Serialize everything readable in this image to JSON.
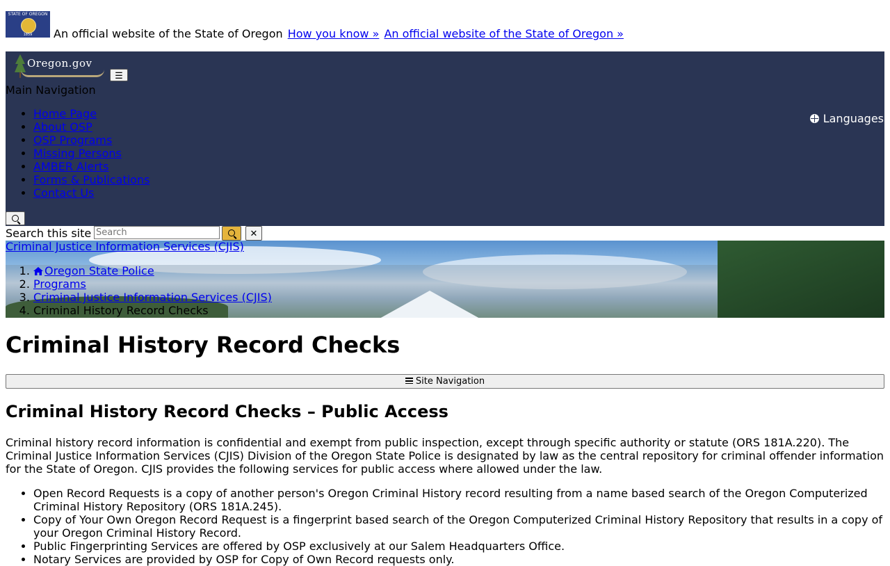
{
  "banner": {
    "flag_alt": "State of Oregon flag",
    "flag_top_text": "STATE OF OREGON",
    "flag_year": "1859",
    "text": "An official website of the State of Oregon",
    "how_link": "How you know »",
    "official_link": "An official website of the State of Oregon »"
  },
  "header": {
    "logo_text": "Oregon.gov",
    "menu_button_label": "☰",
    "main_nav_label": "Main Navigation",
    "nav_items": [
      {
        "label": "Home Page"
      },
      {
        "label": "About OSP"
      },
      {
        "label": "OSP Programs"
      },
      {
        "label": "Missing Persons"
      },
      {
        "label": "AMBER Alerts"
      },
      {
        "label": "Forms & Publications"
      },
      {
        "label": "Contact Us"
      }
    ],
    "languages_label": "Languages"
  },
  "search": {
    "label": "Search this site",
    "placeholder": "Search",
    "close_label": "✕"
  },
  "hero": {
    "title": "Criminal Justice Information Services (CJIS)",
    "breadcrumbs": [
      {
        "label": "Oregon State Police"
      },
      {
        "label": "Programs"
      },
      {
        "label": "Criminal Justice Information Services (CJIS)"
      },
      {
        "label": "Criminal History Record Checks"
      }
    ]
  },
  "main": {
    "page_title": "Criminal History Record Checks",
    "site_nav_label": "Site Navigation",
    "section_title": "Criminal History Record Checks – Public Access",
    "intro": "Criminal history record information is confidential and exempt from public inspection, except through specific authority or statute (ORS 181A.220). The Criminal Justice Information Services (CJIS) Division of the Oregon State Police is designated by law as the central repository for criminal offender information for the State of Oregon. CJIS provides the following services for public access where allowed under the law.",
    "services": [
      "Open Record Requests is a copy of another person's Oregon Criminal History record resulting from a name based search of the Oregon Computerized Criminal History Repository (ORS 181A.245).",
      "Copy of Your Own Oregon Record Request is a fingerprint based search of the Oregon Computerized Criminal History Repository that results in a copy of your Oregon Criminal History Record.",
      "Public Fingerprinting Services are offered by OSP exclusively at our Salem Headquarters Office.",
      "Notary Services are provided by OSP for Copy of Own Record requests only."
    ]
  },
  "colors": {
    "header_bg": "#2a3554",
    "search_button": "#e5b43c",
    "link": "#0000ee"
  }
}
